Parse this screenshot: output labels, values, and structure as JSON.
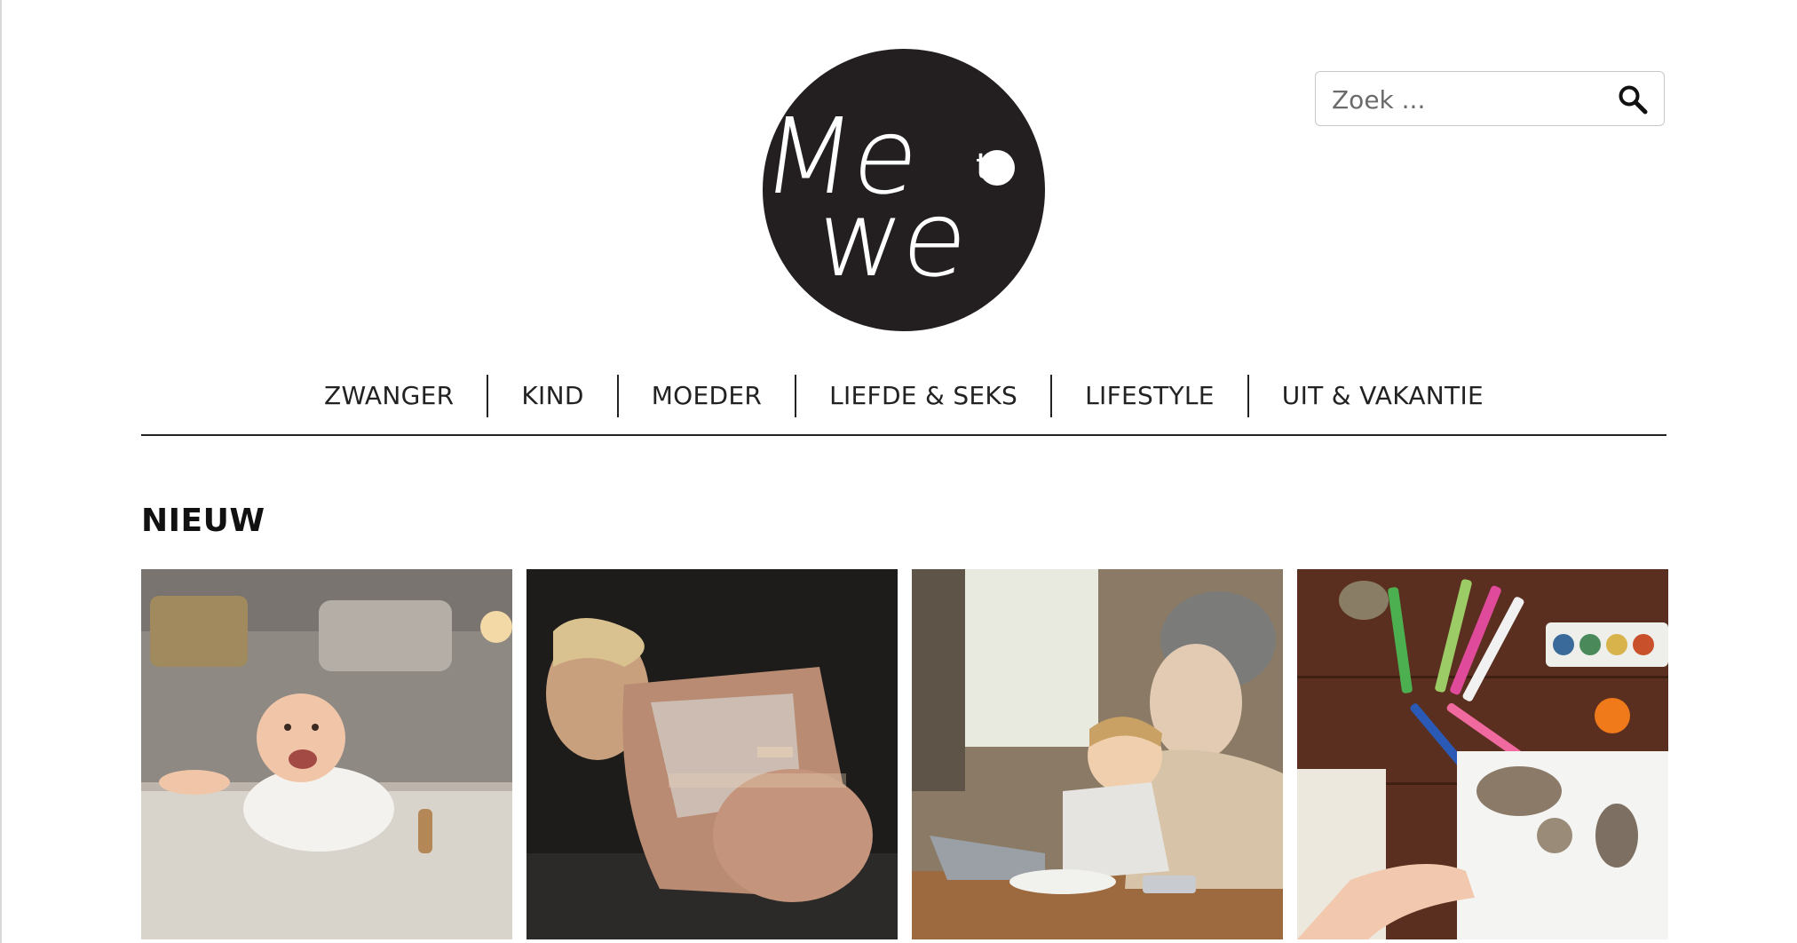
{
  "logo": {
    "alt": "Me to We",
    "line1": "Me",
    "small": "to",
    "line2": "we"
  },
  "search": {
    "placeholder": "Zoek ...",
    "icon": "search-icon"
  },
  "nav": {
    "items": [
      {
        "label": "ZWANGER"
      },
      {
        "label": "KIND"
      },
      {
        "label": "MOEDER"
      },
      {
        "label": "LIEFDE & SEKS"
      },
      {
        "label": "LIFESTYLE"
      },
      {
        "label": "UIT & VAKANTIE"
      }
    ]
  },
  "section": {
    "title": "NIEUW"
  },
  "articles": [
    {
      "image": "baby-crawling-photo"
    },
    {
      "image": "pregnant-woman-resting-photo"
    },
    {
      "image": "mother-child-laptop-photo"
    },
    {
      "image": "craft-table-markers-photo"
    }
  ],
  "colors": {
    "logo_bg": "#231f20",
    "text": "#222222",
    "rule": "#222222"
  }
}
